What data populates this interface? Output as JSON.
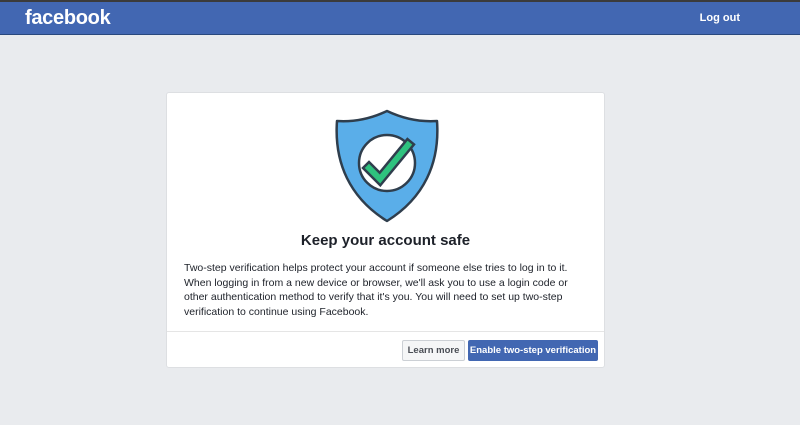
{
  "header": {
    "logo_text": "facebook",
    "logout_label": "Log out"
  },
  "dialog": {
    "title": "Keep your account safe",
    "body": "Two-step verification helps protect your account if someone else tries to log in to it. When logging in from a new device or browser, we'll ask you to use a login code or other authentication method to verify that it's you. You will need to set up two-step verification to continue using Facebook.",
    "learn_more_label": "Learn more",
    "enable_label": "Enable two-step verification",
    "illustration_icon": "shield-check-icon"
  },
  "colors": {
    "brand_blue": "#4267b2",
    "page_background": "#e9ebee",
    "shield_blue": "#5aaee9",
    "check_green": "#2ec27e"
  }
}
